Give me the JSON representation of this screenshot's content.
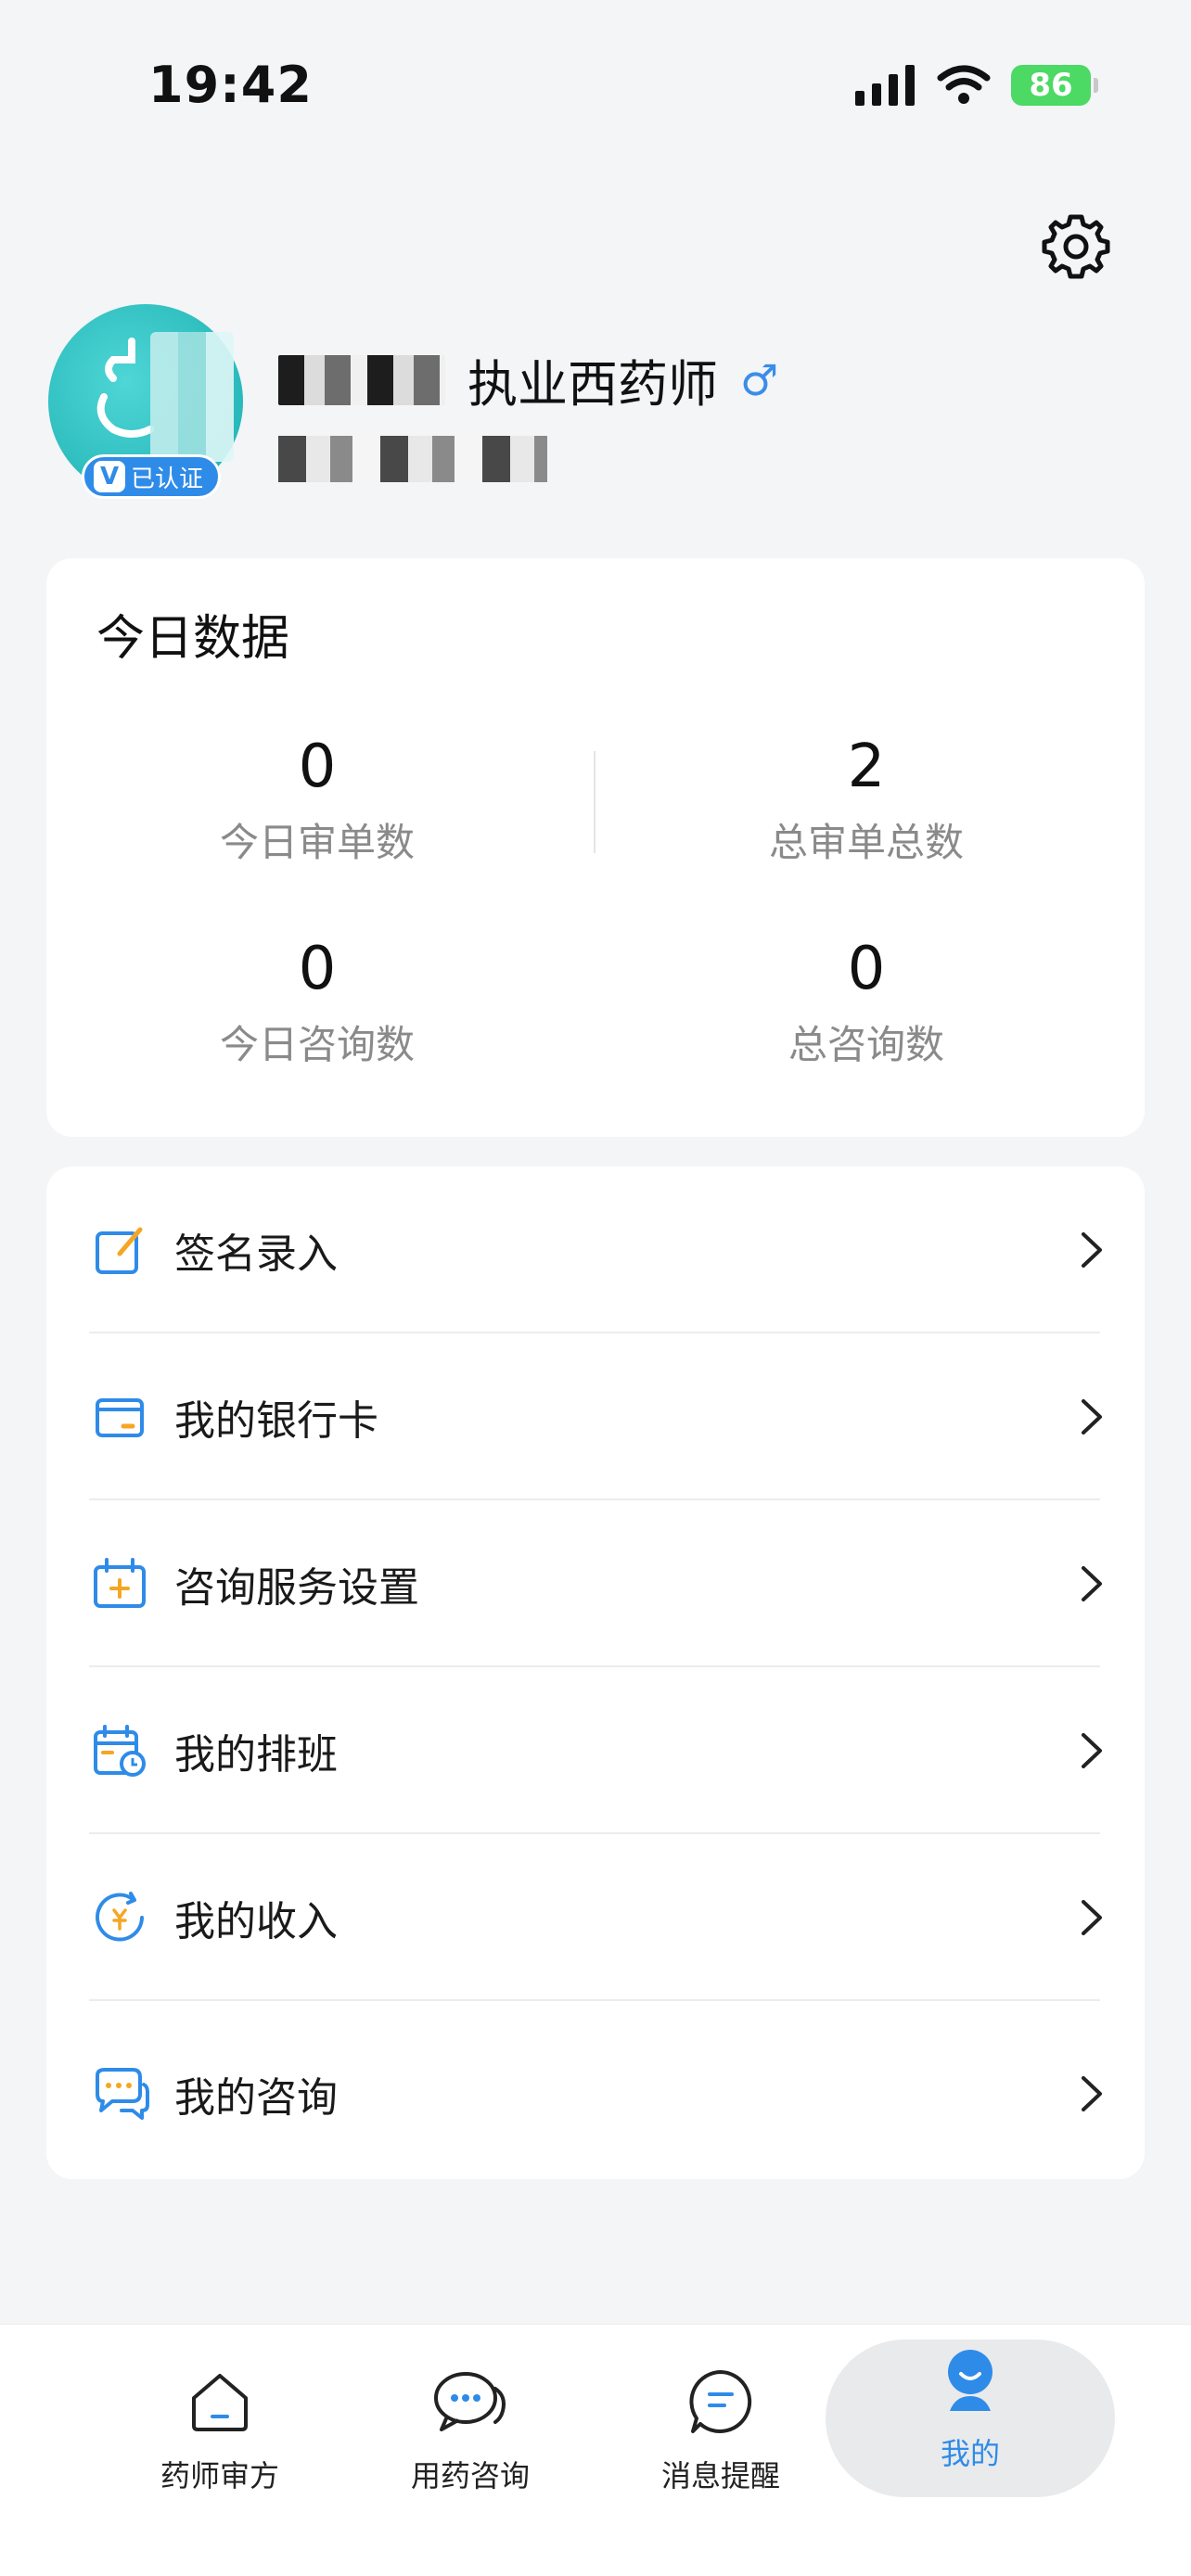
{
  "status_bar": {
    "time": "19:42",
    "battery": "86"
  },
  "profile": {
    "name_suffix": "执业西药师",
    "gender_symbol": "♂",
    "verified_label": "已认证",
    "verified_mark": "V"
  },
  "stats": {
    "title": "今日数据",
    "items": [
      {
        "value": "0",
        "label": "今日审单数"
      },
      {
        "value": "2",
        "label": "总审单总数"
      },
      {
        "value": "0",
        "label": "今日咨询数"
      },
      {
        "value": "0",
        "label": "总咨询数"
      }
    ]
  },
  "menu": {
    "items": [
      {
        "label": "签名录入",
        "icon": "signature-edit-icon"
      },
      {
        "label": "我的银行卡",
        "icon": "bank-card-icon"
      },
      {
        "label": "咨询服务设置",
        "icon": "calendar-plus-icon"
      },
      {
        "label": "我的排班",
        "icon": "schedule-icon"
      },
      {
        "label": "我的收入",
        "icon": "income-icon"
      },
      {
        "label": "我的咨询",
        "icon": "chat-bubbles-icon"
      }
    ]
  },
  "tabs": [
    {
      "label": "药师审方",
      "icon": "home-icon"
    },
    {
      "label": "用药咨询",
      "icon": "chat-dots-icon"
    },
    {
      "label": "消息提醒",
      "icon": "message-icon"
    },
    {
      "label": "我的",
      "icon": "person-icon"
    }
  ],
  "colors": {
    "accent": "#2f8be8",
    "icon_orange": "#f5a623",
    "battery": "#4cd964"
  }
}
